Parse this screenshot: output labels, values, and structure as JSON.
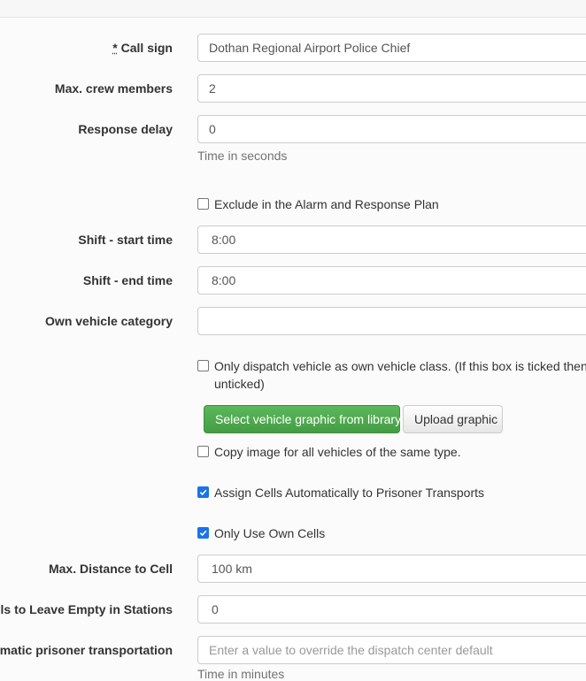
{
  "form": {
    "call_sign": {
      "required_mark": "*",
      "label": "Call sign",
      "value": "Dothan Regional Airport Police Chief"
    },
    "max_crew": {
      "label": "Max. crew members",
      "value": "2"
    },
    "response_delay": {
      "label": "Response delay",
      "value": "0",
      "help": "Time in seconds"
    },
    "exclude_alarm": {
      "label": "Exclude in the Alarm and Response Plan",
      "checked": false
    },
    "shift_start": {
      "label": "Shift - start time",
      "value": "8:00"
    },
    "shift_end": {
      "label": "Shift - end time",
      "value": "8:00"
    },
    "own_vehicle_category": {
      "label": "Own vehicle category",
      "value": ""
    },
    "only_dispatch_own_class": {
      "label_line1": "Only dispatch vehicle as own vehicle class. (If this box is ticked then the",
      "label_line2": "unticked)",
      "checked": false
    },
    "graphic_buttons": {
      "select_library": "Select vehicle graphic from library",
      "upload": "Upload graphic"
    },
    "copy_image": {
      "label": "Copy image for all vehicles of the same type.",
      "checked": false
    },
    "assign_cells": {
      "label": "Assign Cells Automatically to Prisoner Transports",
      "checked": true
    },
    "own_cells": {
      "label": "Only Use Own Cells",
      "checked": true
    },
    "max_distance": {
      "label": "Max. Distance to Cell",
      "value": "100 km"
    },
    "cells_empty": {
      "label": "Cells to Leave Empty in Stations",
      "value": "0"
    },
    "auto_prisoner": {
      "label": "Automatic prisoner transportation",
      "placeholder": "Enter a value to override the dispatch center default",
      "help": "Time in minutes"
    }
  },
  "colors": {
    "primary_green": "#5cb85c",
    "checkbox_blue": "#1a73e8"
  }
}
